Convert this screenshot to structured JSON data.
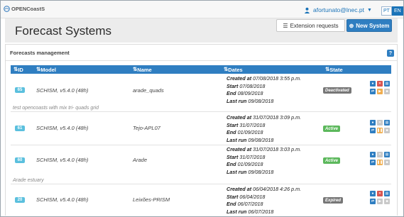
{
  "app": {
    "brand": "OPENCoastS"
  },
  "user": {
    "email": "afortunato@lnec.pt"
  },
  "languages": [
    "PT",
    "EN"
  ],
  "header": {
    "title": "Forecast Systems",
    "extension_label": "Extension requests",
    "new_system_label": "New System"
  },
  "panel": {
    "title": "Forecasts management",
    "help": "?"
  },
  "table": {
    "columns": [
      "ID",
      "Model",
      "Name",
      "Dates",
      "State"
    ],
    "date_labels": {
      "created": "Created at",
      "start": "Start",
      "end": "End",
      "last_run": "Last run"
    },
    "rows": [
      {
        "id": "65",
        "model": "SCHISM, v5.4.0 (48h)",
        "name": "arade_quads",
        "created": "07/08/2018 3:55 p.m.",
        "start": "07/08/2018",
        "end": "08/09/2018",
        "last_run": "09/08/2018",
        "state": "Deactivated",
        "description": "test opencoasts with mix tri- quads grid"
      },
      {
        "id": "61",
        "model": "SCHISM, v5.4.0 (48h)",
        "name": "Tejo-APL07",
        "created": "31/07/2018 3:09 p.m.",
        "start": "31/07/2018",
        "end": "01/09/2018",
        "last_run": "09/08/2018",
        "state": "Active",
        "description": ""
      },
      {
        "id": "60",
        "model": "SCHISM, v5.4.0 (48h)",
        "name": "Arade",
        "created": "31/07/2018 3:03 p.m.",
        "start": "31/07/2018",
        "end": "01/09/2018",
        "last_run": "09/08/2018",
        "state": "Active",
        "description": "Arade estuary"
      },
      {
        "id": "20",
        "model": "SCHISM, v5.4.0 (48h)",
        "name": "Leixões-PRISM",
        "created": "06/04/2018 4:26 p.m.",
        "start": "06/04/2018",
        "end": "06/07/2018",
        "last_run": "06/07/2018",
        "state": "Expired",
        "description": ""
      }
    ]
  },
  "colors": {
    "accent": "#2f7ec1",
    "active": "#5cb85c",
    "inactive": "#777777",
    "id_badge": "#5bc0de",
    "danger": "#d9534f",
    "warning": "#f0ad4e"
  }
}
